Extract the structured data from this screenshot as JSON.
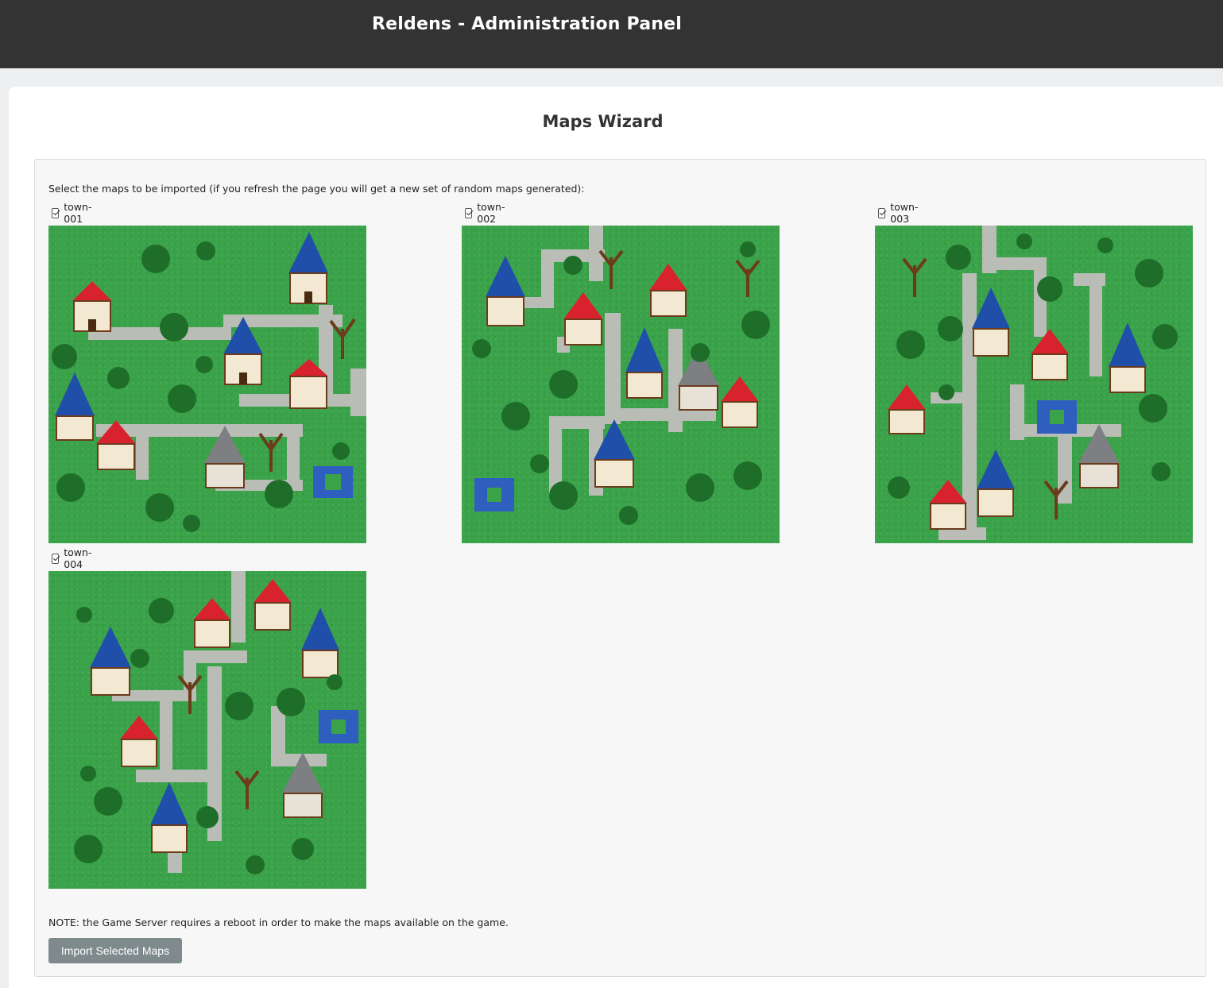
{
  "header": {
    "title": "Reldens - Administration Panel"
  },
  "page": {
    "title": "Maps Wizard"
  },
  "wizard": {
    "instructions": "Select the maps to be imported (if you refresh the page you will get a new set of random maps generated):",
    "maps": [
      {
        "name": "town-001",
        "checked": true
      },
      {
        "name": "town-002",
        "checked": true
      },
      {
        "name": "town-003",
        "checked": true
      },
      {
        "name": "town-004",
        "checked": true
      }
    ],
    "note": "NOTE: the Game Server requires a reboot in order to make the maps available on the game.",
    "import_label": "Import Selected Maps"
  },
  "colors": {
    "header_bg": "#333333",
    "grass": "#3aa34a",
    "path": "#b9bdb5",
    "roof_red": "#d8232e",
    "roof_blue": "#1f4fa8",
    "roof_gray": "#7d7f82",
    "water": "#2e5fbf",
    "button": "#7e8a8c"
  }
}
